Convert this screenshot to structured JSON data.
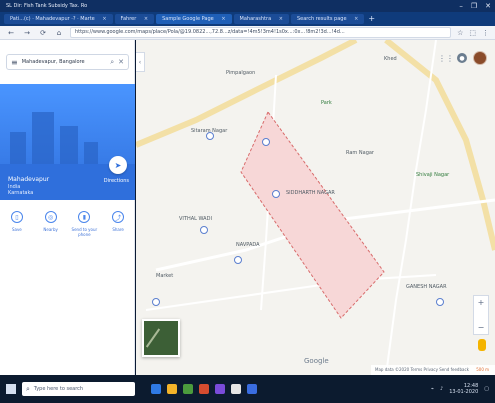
{
  "window": {
    "title": "SL Dir: Fish Tank Subsidy Tax. Ro",
    "controls": [
      "–",
      "❐",
      "✕"
    ]
  },
  "tabs": [
    {
      "label": "Pati...(c) · Mahadevapur ·? · Marte"
    },
    {
      "label": "Fahrer"
    },
    {
      "label": "Sample Google Page",
      "active": true
    },
    {
      "label": "Maharashtra"
    },
    {
      "label": "Search results page"
    }
  ],
  "address": {
    "url": "https://www.google.com/maps/place/Pola/@19.0822...,72.8...z/data=!4m5!3m4!1s0x...:0x...!8m2!3d...!4d..."
  },
  "map": {
    "labels": [
      {
        "text": "Pimpalgaon",
        "kind": "gray"
      },
      {
        "text": "Sitaram Nagar",
        "kind": "gray"
      },
      {
        "text": "Khed",
        "kind": "gray"
      },
      {
        "text": "Shivaji Nagar",
        "kind": "green"
      },
      {
        "text": "SIDDHARTH NAGAR",
        "kind": "gray"
      },
      {
        "text": "Ram Nagar",
        "kind": "gray"
      },
      {
        "text": "VITHAL WADI",
        "kind": "gray"
      },
      {
        "text": "NAVPADA",
        "kind": "gray"
      },
      {
        "text": "GANESH NAGAR",
        "kind": "gray"
      },
      {
        "text": "Market",
        "kind": "gray"
      },
      {
        "text": "Park",
        "kind": "gray"
      }
    ],
    "polygon": {
      "fill": "#f7d7d7",
      "stroke": "#d86b6b"
    },
    "footer": "Map data ©2020 Terms Privacy Send feedback",
    "scale": "500 m"
  },
  "panel": {
    "search_value": "Mahadevapur, Bangalore",
    "place": {
      "name": "Mahadevapur",
      "sub1": "India",
      "sub2": "Karnataka"
    },
    "directions_label": "Directions",
    "actions": [
      {
        "label": "Save",
        "icon": "bookmark-icon"
      },
      {
        "label": "Nearby",
        "icon": "nearby-icon"
      },
      {
        "label": "Send to your phone",
        "icon": "phone-icon"
      },
      {
        "label": "Share",
        "icon": "share-icon"
      }
    ]
  },
  "taskbar": {
    "search_placeholder": "Type here to search",
    "time": "12:48",
    "date": "13-01-2020"
  },
  "colors": {
    "blue": "#2f6fdc",
    "hero": "#3d82ea",
    "tab_active": "#1f5fb7"
  }
}
